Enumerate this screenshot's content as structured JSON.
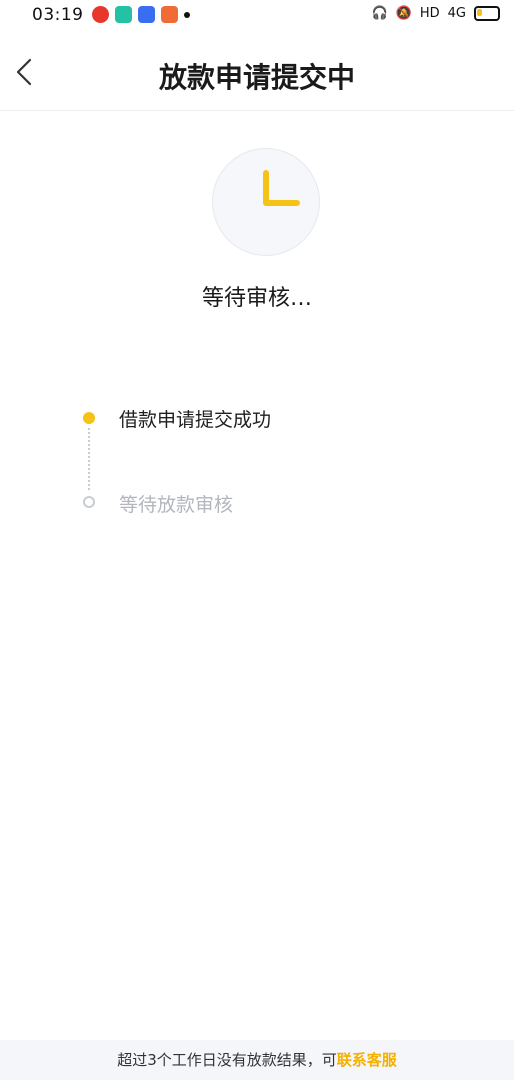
{
  "status_bar": {
    "time": "03:19",
    "network_label": "HD",
    "signal_label": "4G"
  },
  "header": {
    "title": "放款申请提交中"
  },
  "main": {
    "status_text": "等待审核…",
    "timeline": [
      {
        "label": "借款申请提交成功",
        "state": "done"
      },
      {
        "label": "等待放款审核",
        "state": "pending"
      }
    ]
  },
  "footer": {
    "text": "超过3个工作日没有放款结果，可",
    "link": "联系客服"
  },
  "colors": {
    "accent": "#F5C215",
    "pending": "#C9CCD3",
    "link": "#F5B100"
  }
}
